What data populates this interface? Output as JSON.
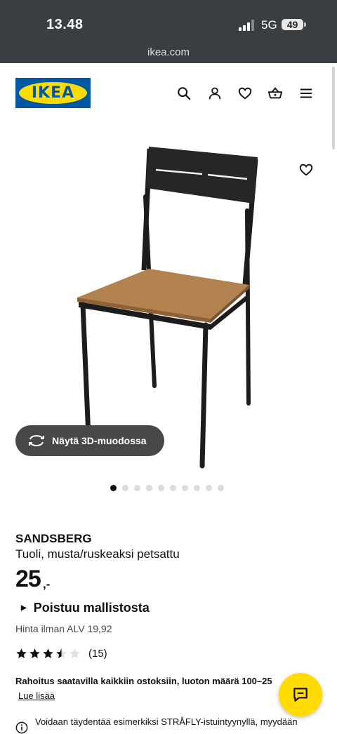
{
  "status_bar": {
    "time": "13.48",
    "network": "5G",
    "battery": "49"
  },
  "browser": {
    "url": "ikea.com"
  },
  "brand": {
    "logo_text": "IKEA",
    "blue": "#0058a3",
    "yellow": "#ffdb00"
  },
  "header_icons": [
    "search-icon",
    "account-icon",
    "heart-icon",
    "basket-icon",
    "menu-icon"
  ],
  "gallery": {
    "view_3d_label": "Näytä 3D-muodossa",
    "image_count": 10,
    "active_index": 0
  },
  "product": {
    "name": "SANDSBERG",
    "description": "Tuoli, musta/ruskeaksi petsattu",
    "price": "25",
    "price_suffix": ",-",
    "status": "Poistuu mallistosta",
    "vat_text": "Hinta ilman ALV 19,92",
    "rating": 3.5,
    "rating_count": "(15)"
  },
  "financing": {
    "text": "Rahoitus saatavilla kaikkiin ostoksiin, luoton määrä 100–25",
    "link": "Lue lisää"
  },
  "info": {
    "text": "Voidaan täydentää esimerkiksi STRÅFLY-istuintyynyllä, myydään"
  }
}
